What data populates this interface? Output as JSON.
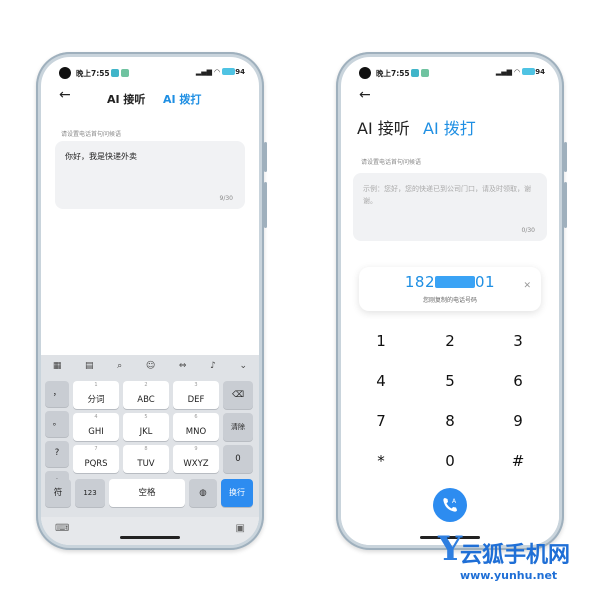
{
  "status": {
    "time": "晚上7:55",
    "battery": "94"
  },
  "left": {
    "tab_answer": "AI 接听",
    "tab_call": "AI 拨打",
    "hint": "请设置电话首句问候语",
    "text": "你好，我是快递外卖",
    "count": "9/30",
    "keyboard": {
      "side_keys": [
        "，",
        "。",
        "?",
        "!"
      ],
      "keys": [
        {
          "num": "1",
          "label": "分词"
        },
        {
          "num": "2",
          "label": "ABC"
        },
        {
          "num": "3",
          "label": "DEF"
        },
        {
          "num": "4",
          "label": "GHI"
        },
        {
          "num": "5",
          "label": "JKL"
        },
        {
          "num": "6",
          "label": "MNO"
        },
        {
          "num": "7",
          "label": "PQRS"
        },
        {
          "num": "8",
          "label": "TUV"
        },
        {
          "num": "9",
          "label": "WXYZ"
        }
      ],
      "delete_all": "清除",
      "zero": "0",
      "symbol": "符",
      "num123": "123",
      "space": "空格",
      "enter": "换行"
    }
  },
  "right": {
    "tab_answer": "AI 接听",
    "tab_call": "AI 拨打",
    "hint": "请设置电话首句问候语",
    "placeholder": "示例：您好，您的快递已到公司门口，请及时领取，谢谢。",
    "count": "0/30",
    "number_prefix": "182",
    "number_suffix": "01",
    "number_sub": "您刚复制的电话号码",
    "dialpad": [
      "1",
      "2",
      "3",
      "4",
      "5",
      "6",
      "7",
      "8",
      "9",
      "*",
      "0",
      "#"
    ]
  },
  "watermark": {
    "brand": "云狐手机网",
    "url": "www.yunhu.net",
    "letter": "Y"
  },
  "colors": {
    "accent": "#1f8fe3",
    "key_blue": "#2d8cf0"
  }
}
